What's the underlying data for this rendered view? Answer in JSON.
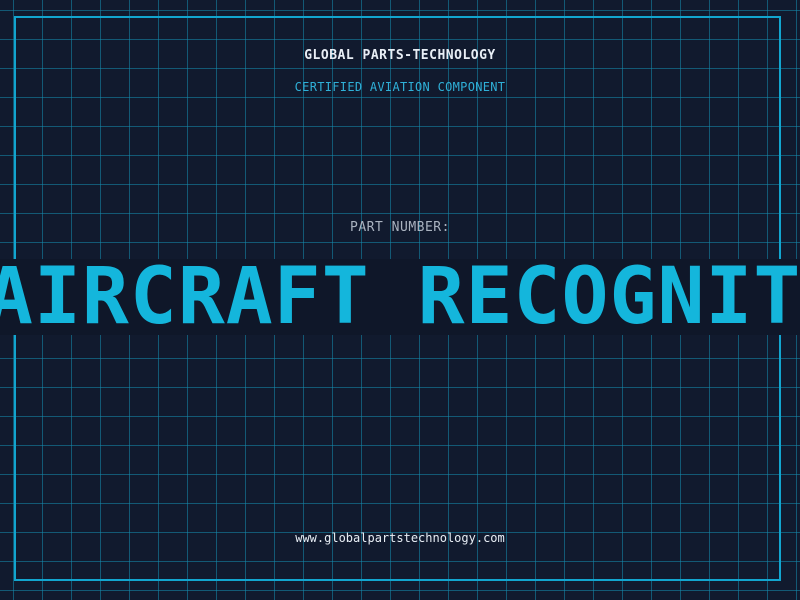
{
  "header": {
    "company": "GLOBAL PARTS-TECHNOLOGY",
    "subtitle": "CERTIFIED AVIATION COMPONENT"
  },
  "part": {
    "label": "PART NUMBER:",
    "value": "AIRCRAFT RECOGNITION"
  },
  "footer": {
    "website": "www.globalpartstechnology.com"
  },
  "colors": {
    "background": "#111a2e",
    "accent": "#14b6dc",
    "grid": "#148caf",
    "text": "#e8eef5"
  }
}
